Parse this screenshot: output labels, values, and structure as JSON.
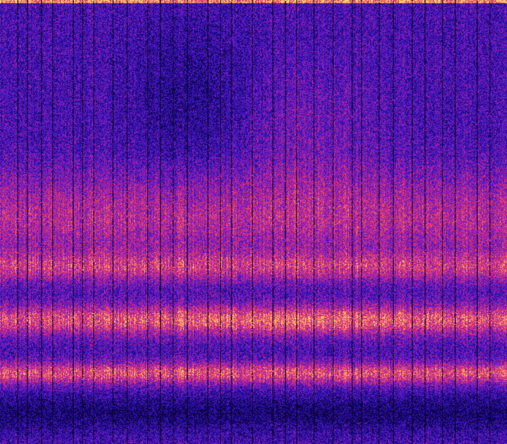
{
  "image": {
    "kind": "spectrogram-heatmap",
    "colormap": [
      "#0a0030",
      "#1c0a8a",
      "#3a18c8",
      "#8a1ec0",
      "#d0287a",
      "#f0506a",
      "#ffd060",
      "#fff080"
    ],
    "background_color": "#1a0a6e",
    "dropout_line_color": "#05001a",
    "bright_bands": [
      {
        "center": 0.6,
        "label": ""
      },
      {
        "center": 0.72,
        "label": ""
      },
      {
        "center": 0.84,
        "label": ""
      }
    ]
  }
}
